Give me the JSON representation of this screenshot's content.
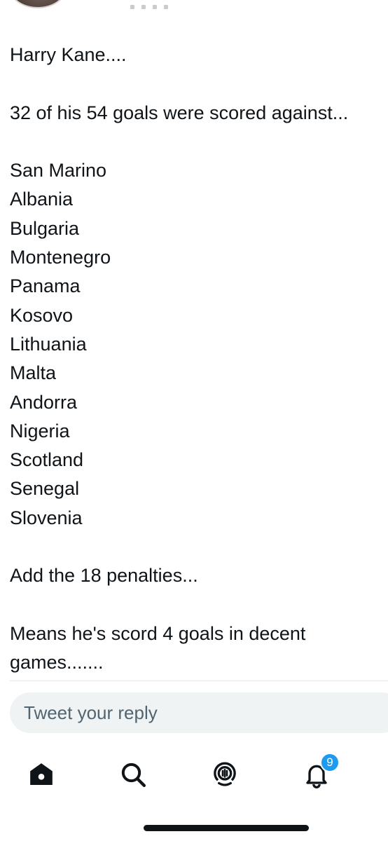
{
  "tweet": {
    "lines": [
      "Harry Kane....",
      "",
      "32 of his 54 goals were scored against...",
      "",
      "San Marino",
      "Albania",
      "Bulgaria",
      "Montenegro",
      "Panama",
      "Kosovo",
      "Lithuania",
      "Malta",
      "Andorra",
      "Nigeria",
      "Scotland",
      "Senegal",
      "Slovenia",
      "",
      "Add the 18 penalties...",
      "",
      "Means he's scord 4 goals in decent",
      "games......."
    ]
  },
  "reply": {
    "placeholder": "Tweet your reply"
  },
  "nav": {
    "home_icon": "home-icon",
    "search_icon": "search-icon",
    "spaces_icon": "spaces-icon",
    "notifications_icon": "bell-icon",
    "notifications_badge": "9"
  },
  "colors": {
    "accent": "#1d9bf0",
    "text": "#0f1419",
    "secondary": "#536471",
    "reply_bg": "#eff3f4"
  }
}
